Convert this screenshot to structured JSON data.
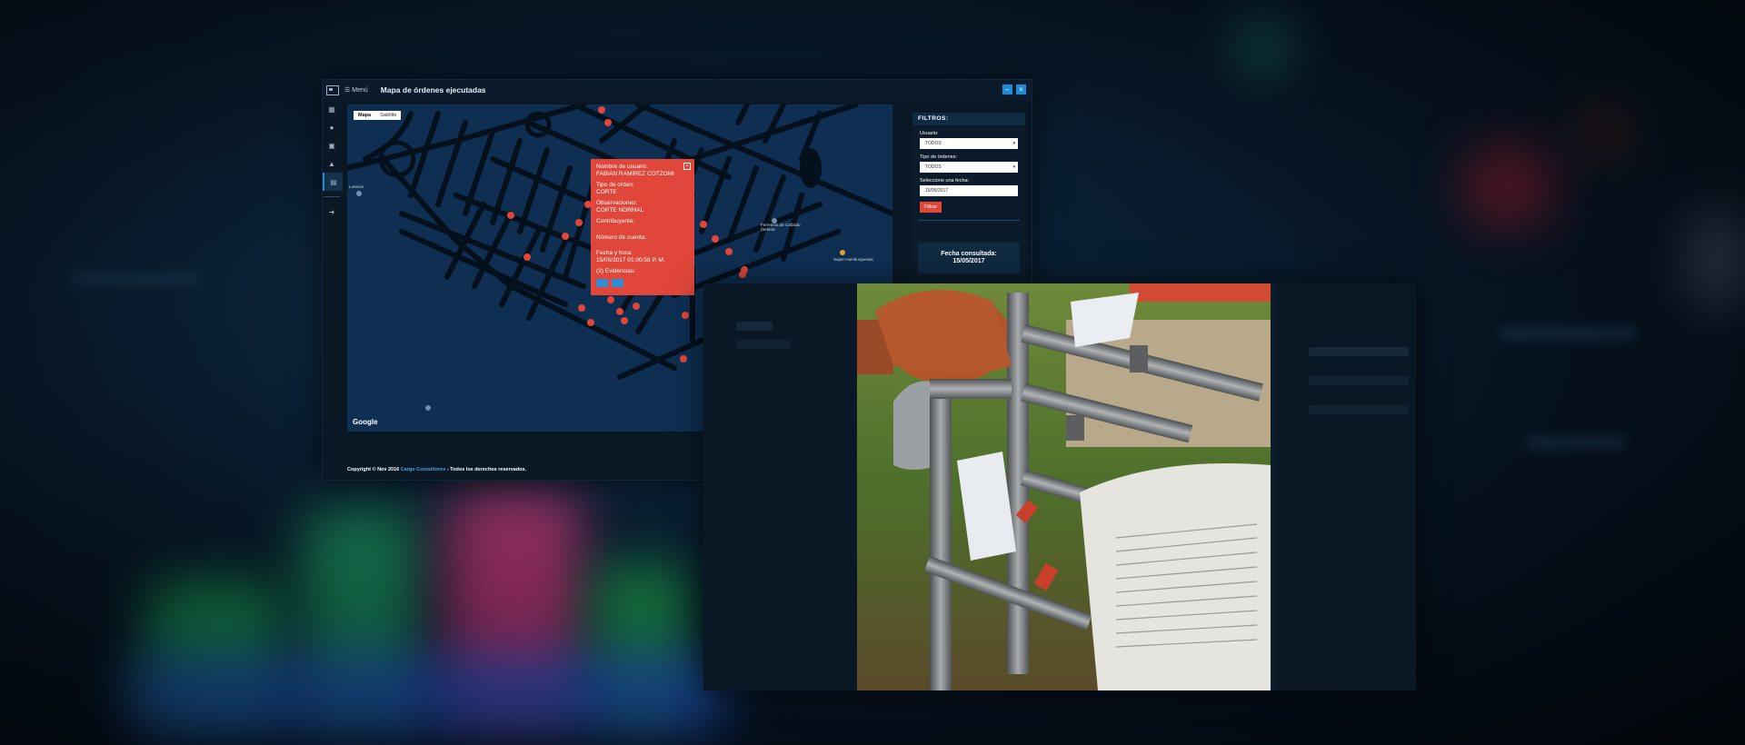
{
  "window": {
    "menu_label": "Menú",
    "title": "Mapa de órdenes ejecutadas"
  },
  "map": {
    "tabs": [
      "Mapa",
      "Satélite"
    ],
    "active_tab": "Mapa",
    "provider": "Google",
    "labels": [
      "Lorenzo",
      "Super Hamburguesas",
      "Ferreteria de Calzado Zertena"
    ],
    "marker_color": "#e0473a"
  },
  "popup": {
    "usuario_label": "Nombre de usuario:",
    "usuario_value": "FABIAN RAMIREZ COTZOMI",
    "tipo_label": "Tipo de orden:",
    "tipo_value": "CORTE",
    "obs_label": "Observaciones:",
    "obs_value": "CORTE NORMAL",
    "contribuyente_label": "Contribuyente:",
    "cuenta_label": "Número de cuenta:",
    "fecha_label": "Fecha y hora:",
    "fecha_value": "15/05/2017 01:00:58 P. M.",
    "evidencias_label": "(2) Evidencias:"
  },
  "filters": {
    "heading": "FILTROS:",
    "usuario_label": "Usuario:",
    "usuario_value": "TODOS",
    "tipo_label": "Tipo de órdenes:",
    "tipo_value": "TODOS",
    "fecha_label": "Seleccione una fecha:",
    "fecha_value": "15/05/2017",
    "button_label": "Filtrar",
    "consulted_label": "Fecha consultada:",
    "consulted_value": "15/05/2017"
  },
  "footer": {
    "prefix": "Copyright © Nov 2016",
    "brand": "Cargo Consultores",
    "suffix": "- Todos los derechos reservados."
  },
  "colors": {
    "accent": "#1e8bd4",
    "danger": "#e0473a",
    "map_bg": "#0e2f52"
  },
  "icons": [
    "dashboard-icon",
    "info-icon",
    "camera-icon",
    "user-icon",
    "calendar-icon",
    "logout-icon"
  ]
}
